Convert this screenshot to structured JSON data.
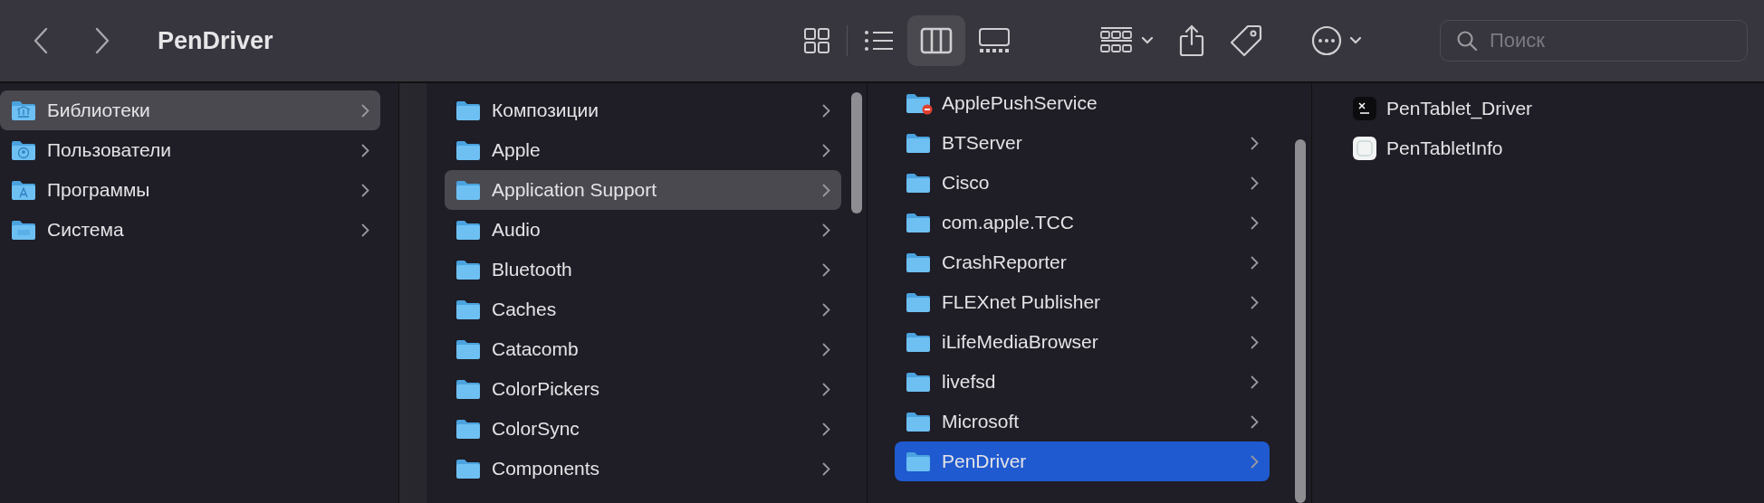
{
  "toolbar": {
    "title": "PenDriver",
    "view_modes": [
      {
        "kind": "icons",
        "selected": false
      },
      {
        "kind": "list",
        "selected": false
      },
      {
        "kind": "columns",
        "selected": true
      },
      {
        "kind": "gallery",
        "selected": false
      }
    ],
    "search": {
      "placeholder": "Поиск"
    }
  },
  "columns": [
    {
      "items": [
        {
          "name": "Библиотеки",
          "kind": "library",
          "selected": true,
          "arrow": true
        },
        {
          "name": "Пользователи",
          "kind": "users",
          "selected": false,
          "arrow": true
        },
        {
          "name": "Программы",
          "kind": "apps",
          "selected": false,
          "arrow": true
        },
        {
          "name": "Система",
          "kind": "system",
          "selected": false,
          "arrow": true
        }
      ]
    },
    {
      "items": [
        {
          "name": "Композиции",
          "kind": "folder",
          "selected": false,
          "arrow": true
        },
        {
          "name": "Apple",
          "kind": "folder",
          "selected": false,
          "arrow": true
        },
        {
          "name": "Application Support",
          "kind": "folder",
          "selected": true,
          "arrow": true
        },
        {
          "name": "Audio",
          "kind": "folder",
          "selected": false,
          "arrow": true
        },
        {
          "name": "Bluetooth",
          "kind": "folder",
          "selected": false,
          "arrow": true
        },
        {
          "name": "Caches",
          "kind": "folder",
          "selected": false,
          "arrow": true
        },
        {
          "name": "Catacomb",
          "kind": "folder",
          "selected": false,
          "arrow": true
        },
        {
          "name": "ColorPickers",
          "kind": "folder",
          "selected": false,
          "arrow": true
        },
        {
          "name": "ColorSync",
          "kind": "folder",
          "selected": false,
          "arrow": true
        },
        {
          "name": "Components",
          "kind": "folder",
          "selected": false,
          "arrow": true
        }
      ]
    },
    {
      "items": [
        {
          "name": "ApplePushService",
          "kind": "restricted",
          "selected": false,
          "arrow": false
        },
        {
          "name": "BTServer",
          "kind": "folder",
          "selected": false,
          "arrow": true
        },
        {
          "name": "Cisco",
          "kind": "folder",
          "selected": false,
          "arrow": true
        },
        {
          "name": "com.apple.TCC",
          "kind": "folder",
          "selected": false,
          "arrow": true
        },
        {
          "name": "CrashReporter",
          "kind": "folder",
          "selected": false,
          "arrow": true
        },
        {
          "name": "FLEXnet Publisher",
          "kind": "folder",
          "selected": false,
          "arrow": true
        },
        {
          "name": "iLifeMediaBrowser",
          "kind": "folder",
          "selected": false,
          "arrow": true
        },
        {
          "name": "livefsd",
          "kind": "folder",
          "selected": false,
          "arrow": true
        },
        {
          "name": "Microsoft",
          "kind": "folder",
          "selected": false,
          "arrow": true
        },
        {
          "name": "PenDriver",
          "kind": "folder",
          "selected": true,
          "arrow": true
        }
      ]
    },
    {
      "items": [
        {
          "name": "PenTablet_Driver",
          "kind": "app",
          "selected": false,
          "arrow": false
        },
        {
          "name": "PenTabletInfo",
          "kind": "doc",
          "selected": false,
          "arrow": false
        }
      ]
    }
  ]
}
